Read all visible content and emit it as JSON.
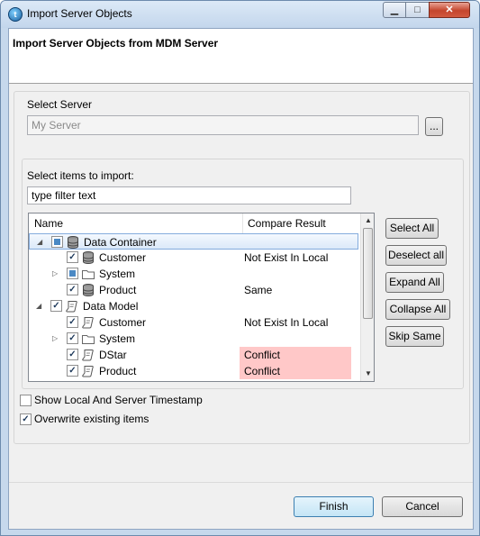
{
  "window": {
    "title": "Import Server Objects"
  },
  "header": {
    "title": "Import Server Objects from MDM Server"
  },
  "server": {
    "group_label": "Select Server",
    "value": "My Server",
    "browse_label": "..."
  },
  "items": {
    "label": "Select items to import:",
    "filter_value": "type filter text",
    "columns": {
      "name": "Name",
      "result": "Compare Result"
    },
    "rows": [
      {
        "name": "Data Container",
        "result": "",
        "level": 0,
        "expander": "expanded",
        "check": "partial",
        "icon": "database-icon",
        "selected": true
      },
      {
        "name": "Customer",
        "result": "Not Exist In Local",
        "level": 1,
        "expander": "none",
        "check": "checked",
        "icon": "database-icon"
      },
      {
        "name": "System",
        "result": "",
        "level": 1,
        "expander": "collapsed",
        "check": "partial",
        "icon": "folder-icon"
      },
      {
        "name": "Product",
        "result": "Same",
        "level": 1,
        "expander": "none",
        "check": "checked",
        "icon": "database-icon"
      },
      {
        "name": "Data Model",
        "result": "",
        "level": 0,
        "expander": "expanded",
        "check": "checked",
        "icon": "model-icon"
      },
      {
        "name": "Customer",
        "result": "Not Exist In Local",
        "level": 1,
        "expander": "none",
        "check": "checked",
        "icon": "model-icon"
      },
      {
        "name": "System",
        "result": "",
        "level": 1,
        "expander": "collapsed",
        "check": "checked",
        "icon": "folder-icon"
      },
      {
        "name": "DStar",
        "result": "Conflict",
        "level": 1,
        "expander": "none",
        "check": "checked",
        "icon": "model-icon",
        "conflict": true
      },
      {
        "name": "Product",
        "result": "Conflict",
        "level": 1,
        "expander": "none",
        "check": "checked",
        "icon": "model-icon",
        "conflict": true
      }
    ],
    "conflict_color": "#ffc8c8"
  },
  "side_buttons": {
    "select_all": "Select All",
    "deselect_all": "Deselect all",
    "expand_all": "Expand All",
    "collapse_all": "Collapse All",
    "skip_same": "Skip Same"
  },
  "options": {
    "show_timestamp": {
      "label": "Show Local And Server Timestamp",
      "checked": false
    },
    "overwrite": {
      "label": "Overwrite existing items",
      "checked": true
    }
  },
  "footer": {
    "finish": "Finish",
    "cancel": "Cancel"
  }
}
